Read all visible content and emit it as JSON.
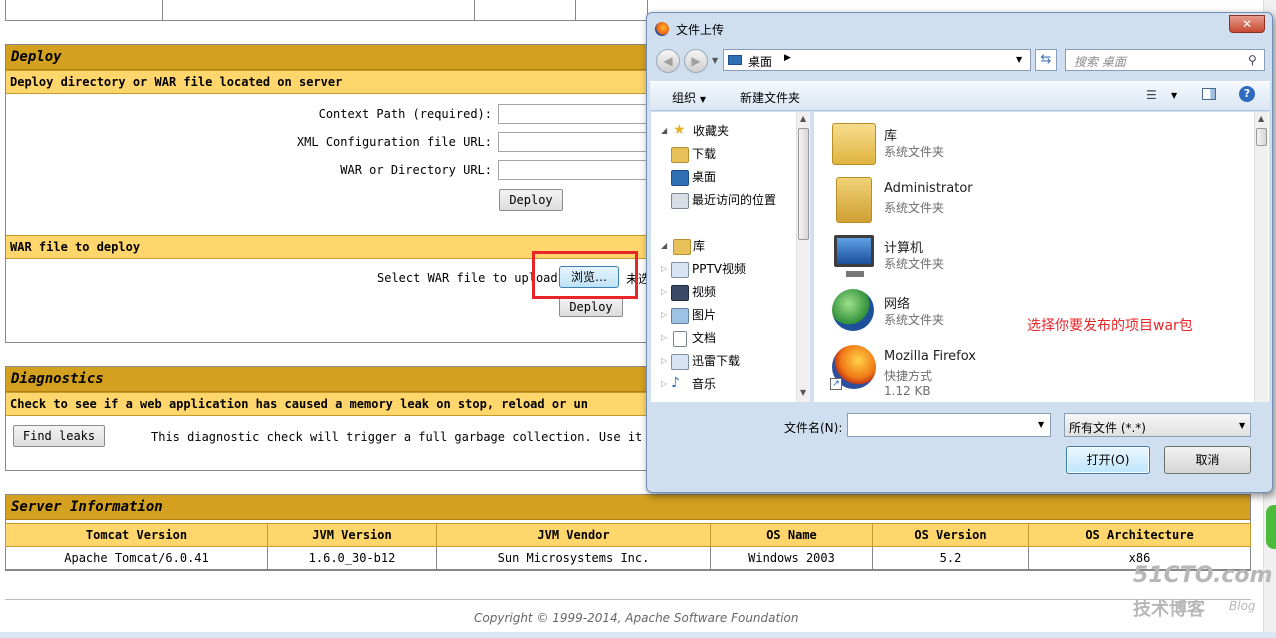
{
  "deploy": {
    "title": "Deploy",
    "server_subtitle": "Deploy directory or WAR file located on server",
    "context_path_label": "Context Path (required):",
    "xml_config_label": "XML Configuration file URL:",
    "war_dir_label": "WAR or Directory URL:",
    "deploy_button": "Deploy",
    "war_subtitle": "WAR file to deploy",
    "select_war_label": "Select WAR file to upload",
    "browse_button": "浏览…",
    "behind_text": "未选",
    "upload_deploy_button": "Deploy"
  },
  "diagnostics": {
    "title": "Diagnostics",
    "subtitle": "Check to see if a web application has caused a memory leak on stop, reload or un",
    "find_leaks_button": "Find leaks",
    "description": "This diagnostic check will trigger a full garbage collection. Use it wi"
  },
  "server_info": {
    "title": "Server Information",
    "columns": [
      "Tomcat Version",
      "JVM Version",
      "JVM Vendor",
      "OS Name",
      "OS Version",
      "OS Architecture"
    ],
    "values": [
      "Apache Tomcat/6.0.41",
      "1.6.0_30-b12",
      "Sun Microsystems Inc.",
      "Windows 2003",
      "5.2",
      "x86"
    ]
  },
  "footer": "Copyright © 1999-2014, Apache Software Foundation",
  "watermark": {
    "line1": "51CTO.com",
    "line2": "技术博客",
    "line3": "Blog"
  },
  "dialog": {
    "title": "文件上传",
    "close": "✕",
    "location": "桌面",
    "search_placeholder": "搜索 桌面",
    "organize": "组织",
    "new_folder": "新建文件夹",
    "nav": [
      {
        "label": "收藏夹",
        "icon": "star-icon"
      },
      {
        "label": "下载",
        "icon": "download-folder-icon"
      },
      {
        "label": "桌面",
        "icon": "desktop-icon"
      },
      {
        "label": "最近访问的位置",
        "icon": "recent-places-icon"
      },
      {
        "label": "库",
        "icon": "library-icon"
      },
      {
        "label": "PPTV视频",
        "icon": "video-library-icon"
      },
      {
        "label": "视频",
        "icon": "film-icon"
      },
      {
        "label": "图片",
        "icon": "picture-icon"
      },
      {
        "label": "文档",
        "icon": "document-icon"
      },
      {
        "label": "迅雷下载",
        "icon": "xunlei-folder-icon"
      },
      {
        "label": "音乐",
        "icon": "music-icon"
      }
    ],
    "files": [
      {
        "name": "库",
        "type": "系统文件夹",
        "size": "",
        "icon": "library-folder-icon"
      },
      {
        "name": "Administrator",
        "type": "系统文件夹",
        "size": "",
        "icon": "user-folder-icon"
      },
      {
        "name": "计算机",
        "type": "系统文件夹",
        "size": "",
        "icon": "computer-icon"
      },
      {
        "name": "网络",
        "type": "系统文件夹",
        "size": "",
        "icon": "network-icon"
      },
      {
        "name": "Mozilla Firefox",
        "type": "快捷方式",
        "size": "1.12 KB",
        "icon": "firefox-icon"
      }
    ],
    "annotation": "选择你要发布的项目war包",
    "filename_label": "文件名(N):",
    "filename_value": "",
    "filter_value": "所有文件 (*.*)",
    "open_button": "打开(O)",
    "cancel_button": "取消"
  },
  "colors": {
    "section_header": "#d4a020",
    "subheader": "#ffd66b",
    "highlight_box": "#e8262a",
    "annotation_text": "#e8262a"
  }
}
